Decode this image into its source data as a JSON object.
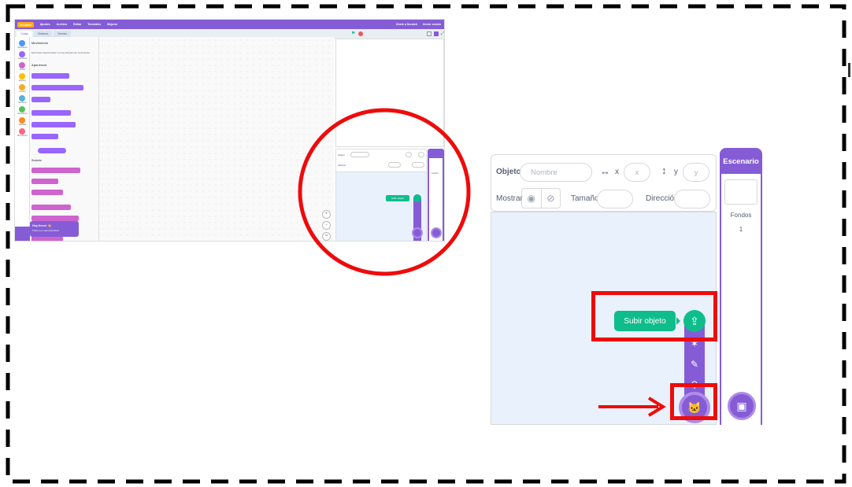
{
  "thumbnail": {
    "menu": {
      "logo": "Scratch",
      "items": [
        "Ajustes",
        "Archivo",
        "Editar",
        "Tutoriales",
        "Mejorar"
      ],
      "right": [
        "Únete a Scratch",
        "Iniciar sesión"
      ]
    },
    "tabs": [
      "Código",
      "Disfraces",
      "Sonidos"
    ],
    "categories": [
      {
        "label": "Movimiento",
        "color": "#4c97ff"
      },
      {
        "label": "Apariencia",
        "color": "#9966ff"
      },
      {
        "label": "Sonido",
        "color": "#cf63cf"
      },
      {
        "label": "Eventos",
        "color": "#ffbf00"
      },
      {
        "label": "Control",
        "color": "#ffab19"
      },
      {
        "label": "Sensores",
        "color": "#5cb1d6"
      },
      {
        "label": "Operadores",
        "color": "#59c059"
      },
      {
        "label": "Variables",
        "color": "#ff8c1a"
      },
      {
        "label": "Mis bloques",
        "color": "#ff6680"
      }
    ],
    "palette": {
      "section_motion": "Movimiento",
      "motion_note": "Escenario seleccionado: no hay bloques de movimiento",
      "section_looks": "Apariencia",
      "section_sound": "Sonido"
    },
    "toast": {
      "title": "Hey there! 👋",
      "body": "There is a new extension!"
    },
    "upload_tooltip": "Subir objeto"
  },
  "panel": {
    "sprite_label": "Objeto",
    "name_placeholder": "Nombre",
    "x_label": "x",
    "x_placeholder": "x",
    "y_label": "y",
    "y_placeholder": "y",
    "show_label": "Mostrar",
    "size_label": "Tamaño",
    "direction_label": "Dirección",
    "stage_header": "Escenario",
    "backdrops_label": "Fondos",
    "backdrops_count": "1",
    "upload_tooltip": "Subir objeto"
  },
  "colors": {
    "scratch_purple": "#855cd6",
    "upload_green": "#0fbd8c",
    "annotation_red": "#ee0b0b"
  }
}
